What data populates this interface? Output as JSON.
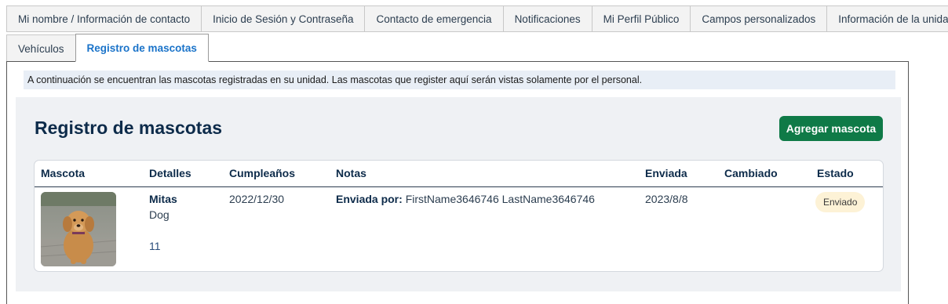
{
  "tabs_row1": [
    "Mi nombre / Información de contacto",
    "Inicio de Sesión y Contraseña",
    "Contacto de emergencia",
    "Notificaciones",
    "Mi Perfil Público",
    "Campos personalizados",
    "Información de la unidad"
  ],
  "tabs_row2": [
    "Vehículos",
    "Registro de mascotas"
  ],
  "active_tab": "Registro de mascotas",
  "notice": "A continuación se encuentran las mascotas registradas en su unidad. Las mascotas que register aquí serán vistas solamente por el personal.",
  "section": {
    "title": "Registro de mascotas",
    "add_button": "Agregar mascota"
  },
  "table": {
    "headers": {
      "pet": "Mascota",
      "details": "Detalles",
      "birthday": "Cumpleaños",
      "notes": "Notas",
      "sent": "Enviada",
      "changed": "Cambiado",
      "status": "Estado"
    },
    "rows": [
      {
        "name": "Mitas",
        "species": "Dog",
        "age": "11",
        "birthday": "2022/12/30",
        "notes_label": "Enviada por:",
        "notes_value": "FirstName3646746 LastName3646746",
        "sent": "2023/8/8",
        "changed": "",
        "status": "Enviado"
      }
    ]
  },
  "colors": {
    "accent_tab": "#1a73c9",
    "button_green": "#0f7a47",
    "title_navy": "#0d2b4a",
    "badge_bg": "#fdf2d6"
  }
}
